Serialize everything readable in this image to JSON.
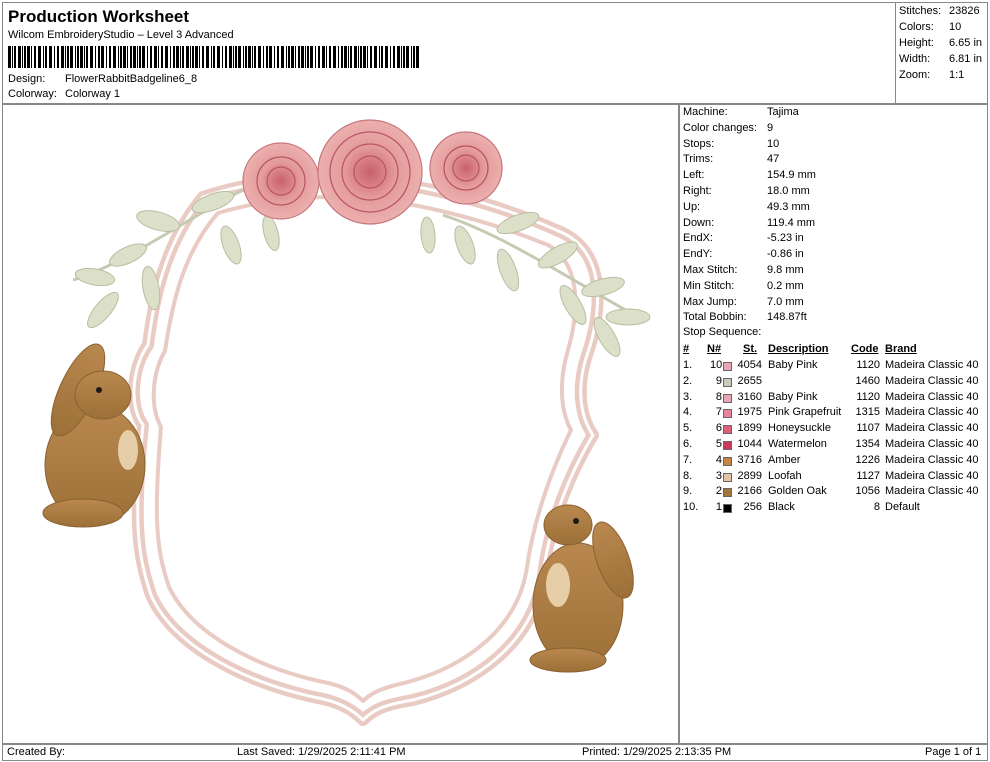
{
  "header": {
    "title": "Production Worksheet",
    "software": "Wilcom EmbroideryStudio – Level 3 Advanced",
    "design_label": "Design:",
    "design_value": "FlowerRabbitBadgeline6_8",
    "colorway_label": "Colorway:",
    "colorway_value": "Colorway 1"
  },
  "summary": {
    "stitches_label": "Stitches:",
    "stitches_value": "23826",
    "colors_label": "Colors:",
    "colors_value": "10",
    "height_label": "Height:",
    "height_value": "6.65 in",
    "width_label": "Width:",
    "width_value": "6.81 in",
    "zoom_label": "Zoom:",
    "zoom_value": "1:1"
  },
  "details": [
    {
      "k": "Machine:",
      "v": "Tajima"
    },
    {
      "k": "Color changes:",
      "v": "9"
    },
    {
      "k": "Stops:",
      "v": "10"
    },
    {
      "k": "Trims:",
      "v": "47"
    },
    {
      "k": "Left:",
      "v": "154.9 mm"
    },
    {
      "k": "Right:",
      "v": "18.0 mm"
    },
    {
      "k": "Up:",
      "v": "49.3 mm"
    },
    {
      "k": "Down:",
      "v": "119.4 mm"
    },
    {
      "k": "EndX:",
      "v": "-5.23 in"
    },
    {
      "k": "EndY:",
      "v": "-0.86 in"
    },
    {
      "k": "Max Stitch:",
      "v": "9.8 mm"
    },
    {
      "k": "Min Stitch:",
      "v": "0.2 mm"
    },
    {
      "k": "Max Jump:",
      "v": "7.0 mm"
    },
    {
      "k": "Total Bobbin:",
      "v": "148.87ft"
    }
  ],
  "stop_sequence": {
    "label": "Stop Sequence:",
    "headers": {
      "idx": "#",
      "num": "N#",
      "st": "St.",
      "desc": "Description",
      "code": "Code",
      "brand": "Brand"
    },
    "rows": [
      {
        "idx": "1.",
        "num": "10",
        "color": "#e8a7b4",
        "st": "4054",
        "desc": "Baby Pink",
        "code": "1120",
        "brand": "Madeira Classic 40"
      },
      {
        "idx": "2.",
        "num": "9",
        "color": "#c9cbbb",
        "st": "2655",
        "desc": "",
        "code": "1460",
        "brand": "Madeira Classic 40"
      },
      {
        "idx": "3.",
        "num": "8",
        "color": "#e8a7b4",
        "st": "3160",
        "desc": "Baby Pink",
        "code": "1120",
        "brand": "Madeira Classic 40"
      },
      {
        "idx": "4.",
        "num": "7",
        "color": "#e7849b",
        "st": "1975",
        "desc": "Pink Grapefruit",
        "code": "1315",
        "brand": "Madeira Classic 40"
      },
      {
        "idx": "5.",
        "num": "6",
        "color": "#e0607a",
        "st": "1899",
        "desc": "Honeysuckle",
        "code": "1107",
        "brand": "Madeira Classic 40"
      },
      {
        "idx": "6.",
        "num": "5",
        "color": "#c93a5b",
        "st": "1044",
        "desc": "Watermelon",
        "code": "1354",
        "brand": "Madeira Classic 40"
      },
      {
        "idx": "7.",
        "num": "4",
        "color": "#c28747",
        "st": "3716",
        "desc": "Amber",
        "code": "1226",
        "brand": "Madeira Classic 40"
      },
      {
        "idx": "8.",
        "num": "3",
        "color": "#e3c3a8",
        "st": "2899",
        "desc": "Loofah",
        "code": "1127",
        "brand": "Madeira Classic 40"
      },
      {
        "idx": "9.",
        "num": "2",
        "color": "#a3763f",
        "st": "2166",
        "desc": "Golden Oak",
        "code": "1056",
        "brand": "Madeira Classic 40"
      },
      {
        "idx": "10.",
        "num": "1",
        "color": "#000000",
        "st": "256",
        "desc": "Black",
        "code": "8",
        "brand": "Default"
      }
    ]
  },
  "footer": {
    "created_by": "Created By:",
    "last_saved": "Last Saved: 1/29/2025 2:11:41 PM",
    "printed": "Printed: 1/29/2025 2:13:35 PM",
    "page": "Page 1 of 1"
  }
}
